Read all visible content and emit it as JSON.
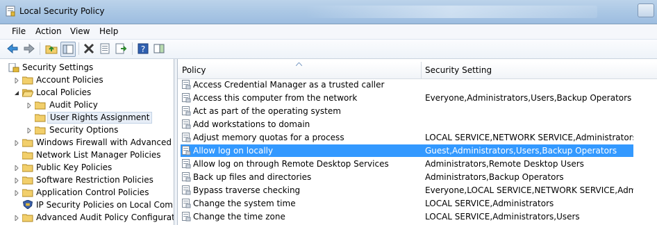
{
  "window": {
    "title": "Local Security Policy"
  },
  "menu": [
    "File",
    "Action",
    "View",
    "Help"
  ],
  "toolbar": {
    "icons": [
      "back-arrow-icon",
      "forward-arrow-icon",
      "up-folder-icon",
      "show-hide-tree-icon",
      "delete-icon",
      "properties-icon",
      "export-list-icon",
      "help-icon",
      "show-pane-icon"
    ]
  },
  "tree": {
    "root": "Security Settings",
    "items": [
      "Account Policies",
      "Local Policies",
      "Audit Policy",
      "User Rights Assignment",
      "Security Options",
      "Windows Firewall with Advanced Secu",
      "Network List Manager Policies",
      "Public Key Policies",
      "Software Restriction Policies",
      "Application Control Policies",
      "IP Security Policies on Local Compute",
      "Advanced Audit Policy Configuration"
    ]
  },
  "list": {
    "columns": [
      "Policy",
      "Security Setting"
    ],
    "rows": [
      {
        "policy": "Access Credential Manager as a trusted caller",
        "setting": ""
      },
      {
        "policy": "Access this computer from the network",
        "setting": "Everyone,Administrators,Users,Backup Operators"
      },
      {
        "policy": "Act as part of the operating system",
        "setting": ""
      },
      {
        "policy": "Add workstations to domain",
        "setting": ""
      },
      {
        "policy": "Adjust memory quotas for a process",
        "setting": "LOCAL SERVICE,NETWORK SERVICE,Administrators"
      },
      {
        "policy": "Allow log on locally",
        "setting": "Guest,Administrators,Users,Backup Operators"
      },
      {
        "policy": "Allow log on through Remote Desktop Services",
        "setting": "Administrators,Remote Desktop Users"
      },
      {
        "policy": "Back up files and directories",
        "setting": "Administrators,Backup Operators"
      },
      {
        "policy": "Bypass traverse checking",
        "setting": "Everyone,LOCAL SERVICE,NETWORK SERVICE,Admini..."
      },
      {
        "policy": "Change the system time",
        "setting": "LOCAL SERVICE,Administrators"
      },
      {
        "policy": "Change the time zone",
        "setting": "LOCAL SERVICE,Administrators,Users"
      }
    ],
    "selected_index": 5
  },
  "colors": {
    "selection": "#3399ff",
    "title_bar": "#a9c6e4"
  }
}
